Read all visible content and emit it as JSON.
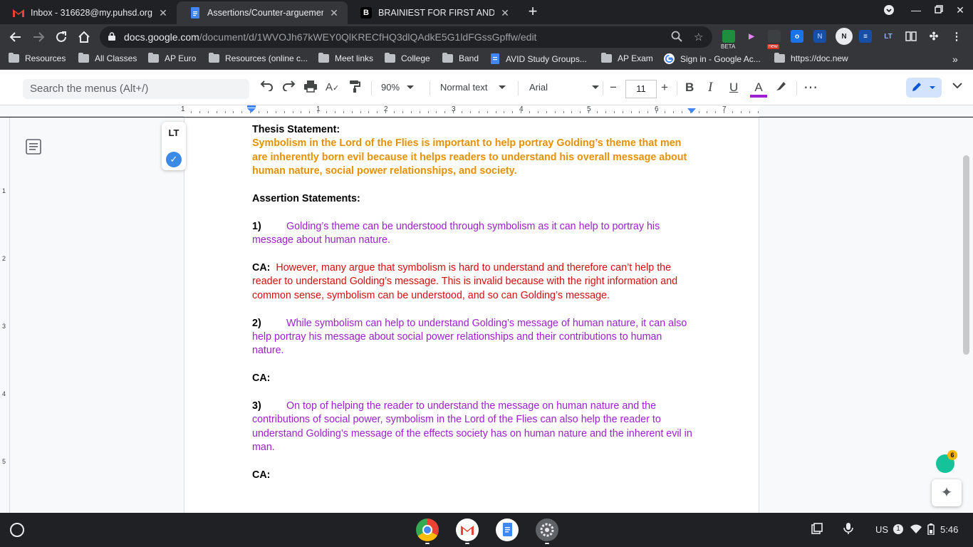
{
  "browser": {
    "tabs": [
      {
        "title": "Inbox - 316628@my.puhsd.org -",
        "icon": "gmail-icon",
        "active": false
      },
      {
        "title": "Assertions/Counter-arguements",
        "icon": "docs-icon",
        "active": true
      },
      {
        "title": "BRAINIEST FOR FIRST AND MOS",
        "icon": "brainly-icon",
        "active": false
      }
    ],
    "new_tab": "+",
    "url_host": "docs.google.com",
    "url_path": "/document/d/1WVOJh67kWEY0QlKRECfHQ3dlQAdkE5G1ldFGssGpffw/edit",
    "ext_beta": "BETA",
    "ext_new": "new",
    "ext_lt": "LT"
  },
  "bookmarks": [
    {
      "label": "Resources",
      "type": "folder"
    },
    {
      "label": "All Classes",
      "type": "folder"
    },
    {
      "label": "AP Euro",
      "type": "folder"
    },
    {
      "label": "Resources (online c...",
      "type": "folder"
    },
    {
      "label": "Meet links",
      "type": "folder"
    },
    {
      "label": "College",
      "type": "folder"
    },
    {
      "label": "Band",
      "type": "folder"
    },
    {
      "label": "AVID Study Groups...",
      "type": "doc"
    },
    {
      "label": "AP Exam",
      "type": "folder"
    },
    {
      "label": "Sign in - Google Ac...",
      "type": "google"
    },
    {
      "label": "https://doc.new",
      "type": "folder"
    }
  ],
  "docs_toolbar": {
    "search_placeholder": "Search the menus (Alt+/)",
    "zoom": "90%",
    "style": "Normal text",
    "font": "Arial",
    "font_size": "11",
    "bold": "B",
    "italic": "I",
    "underline": "U",
    "text_color_letter": "A",
    "more": "⋯"
  },
  "ruler": {
    "h_numbers": [
      "1",
      "1",
      "2",
      "3",
      "4",
      "5",
      "6",
      "7"
    ],
    "v_numbers": [
      "1",
      "2",
      "3",
      "4",
      "5"
    ]
  },
  "document": {
    "thesis_label": "Thesis Statement:",
    "thesis_text": "Symbolism in the Lord of the Flies is important to help portray Golding’s theme that men are inherently born evil because it helps readers to understand his overall message about human nature, social power relationships, and society.",
    "assertions_label": "Assertion Statements:",
    "item1_num": "1)",
    "item1_text": "Golding’s theme can be understood through symbolism as it can help to portray his message about human nature.",
    "ca_label": "CA:",
    "ca1_text": "However, many argue that symbolism is hard to understand and therefore can’t help the reader to understand Golding’s message. This is invalid because with the right information and common sense, symbolism can be understood, and so can Golding’s message.",
    "item2_num": "2)",
    "item2_text": "While symbolism can help to understand Golding’s message of human nature, it can also help portray his message about social power relationships and their contributions to human nature.",
    "item3_num": "3)",
    "item3_text": "On top of helping the reader to understand the message on human nature and the contributions of social power, symbolism in the Lord of the Flies can also help the reader to understand Golding’s message of the effects society has on human nature and the inherent evil in man."
  },
  "lt_panel": {
    "logo": "LT"
  },
  "grammarly_count": "6",
  "shelf": {
    "apps": [
      "chrome-icon",
      "gmail-icon",
      "docs-icon",
      "settings-icon"
    ],
    "locale": "US",
    "notification_count": "1",
    "time": "5:46"
  },
  "colors": {
    "thesis": "#e69100",
    "assertion": "#9e1fd0",
    "counter_argument": "#d50f0f"
  }
}
